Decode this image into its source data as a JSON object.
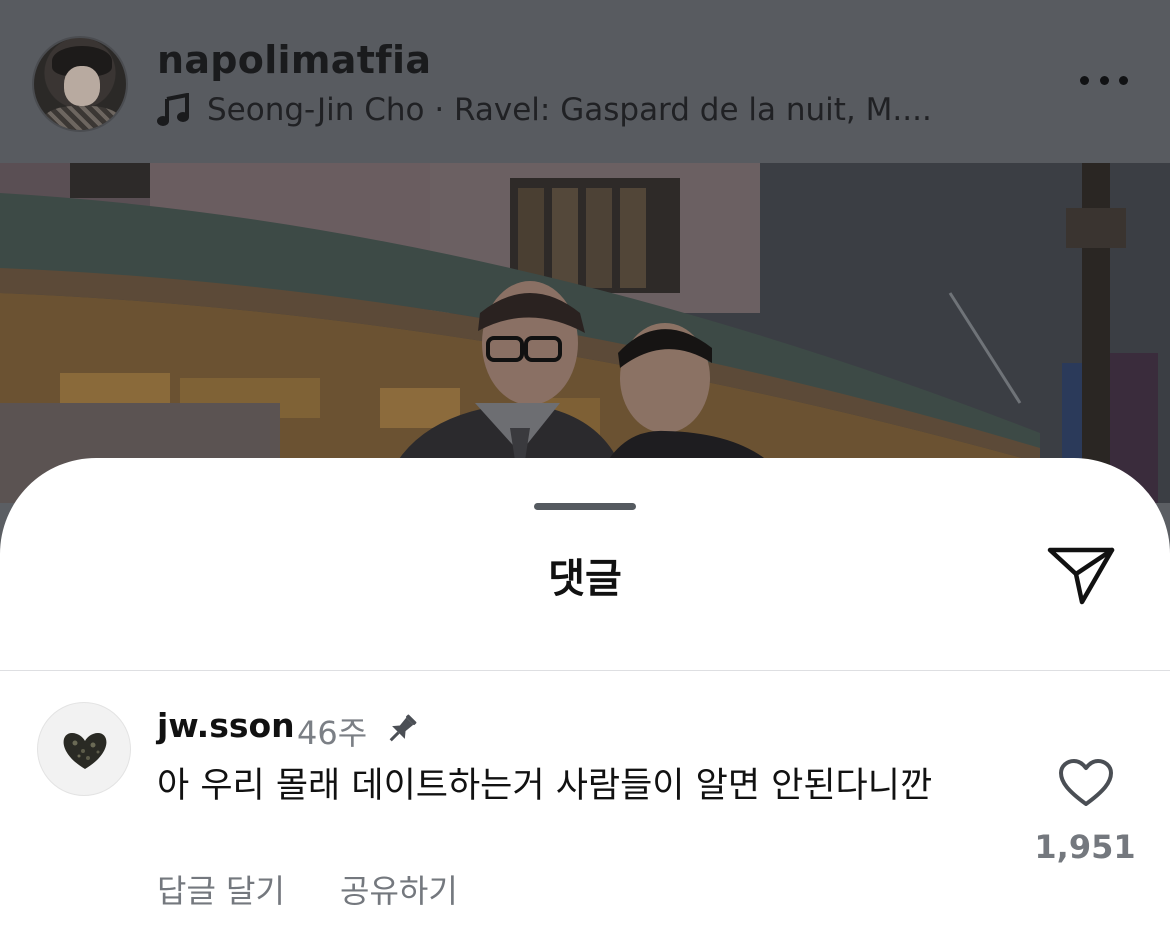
{
  "post": {
    "username": "napolimatfia",
    "music": "Seong-Jin Cho · Ravel: Gaspard de la nuit, M....",
    "icons": {
      "music": "music-note-icon",
      "more": "more-horizontal-icon"
    }
  },
  "sheet": {
    "title": "댓글",
    "send_icon": "send-paper-plane-icon"
  },
  "comment": {
    "username": "jw.sson",
    "time": "46주",
    "pinned": true,
    "text": "아 우리 몰래 데이트하는거 사람들이 알면 안된다니깐",
    "reply_label": "답글 달기",
    "share_label": "공유하기",
    "like_count": "1,951",
    "icons": {
      "pin": "pin-icon",
      "like": "heart-outline-icon"
    }
  }
}
